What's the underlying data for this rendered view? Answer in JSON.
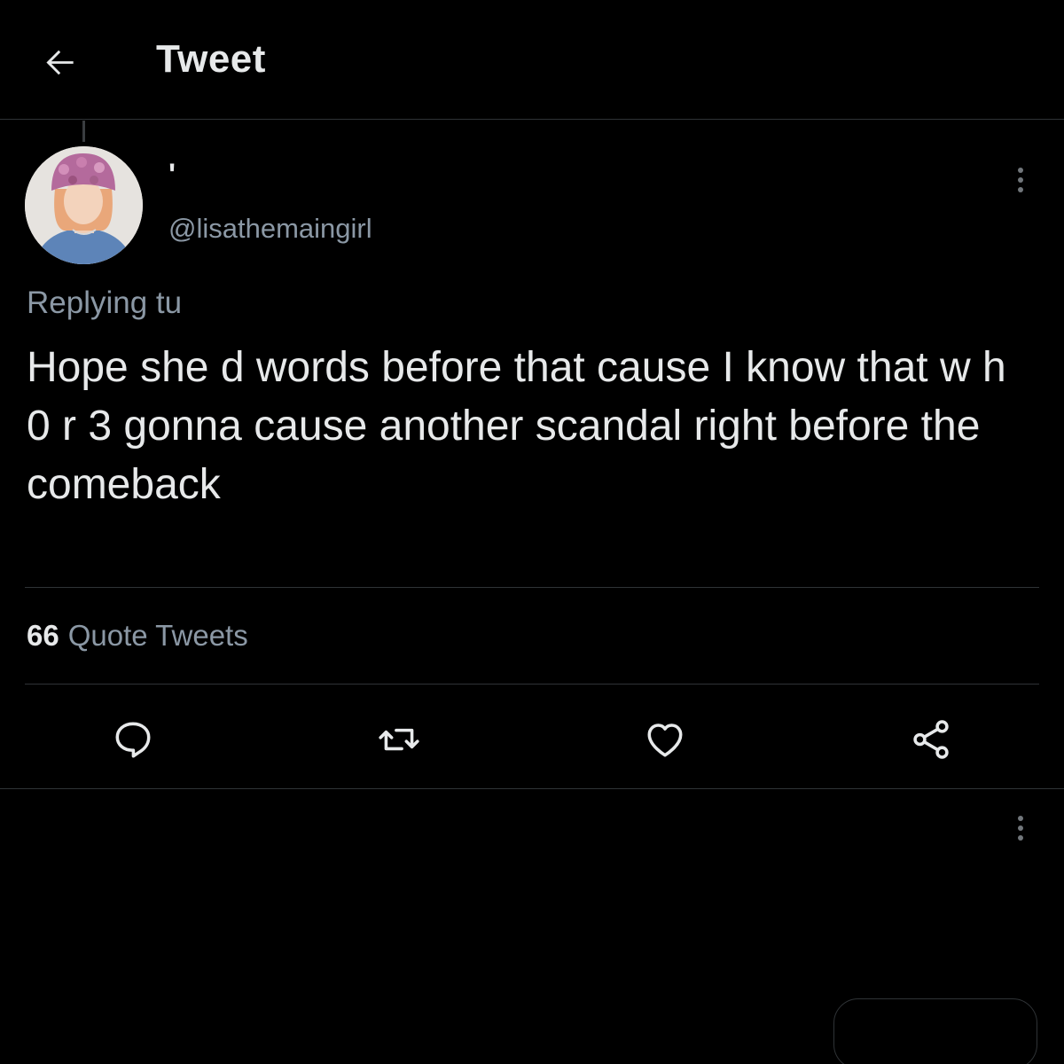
{
  "header": {
    "title": "Tweet",
    "back_icon": "arrow-left-icon"
  },
  "author": {
    "display_name": "'",
    "handle": "@lisathemaingirl",
    "avatar_icon": "avatar-photo"
  },
  "reply_context": {
    "label": "Replying tu"
  },
  "tweet": {
    "text": "Hope she d words before that cause I know that w h 0 r 3 gonna cause another scandal right before the comeback"
  },
  "stats": {
    "quote_count": "66",
    "quote_label": "Quote Tweets"
  },
  "actions": {
    "reply_icon": "reply-bubble-icon",
    "retweet_icon": "retweet-icon",
    "like_icon": "heart-icon",
    "share_icon": "share-icon"
  },
  "colors": {
    "background": "#000000",
    "text_primary": "#e7e9ea",
    "text_secondary": "#8b98a5",
    "divider": "#2f3336"
  }
}
